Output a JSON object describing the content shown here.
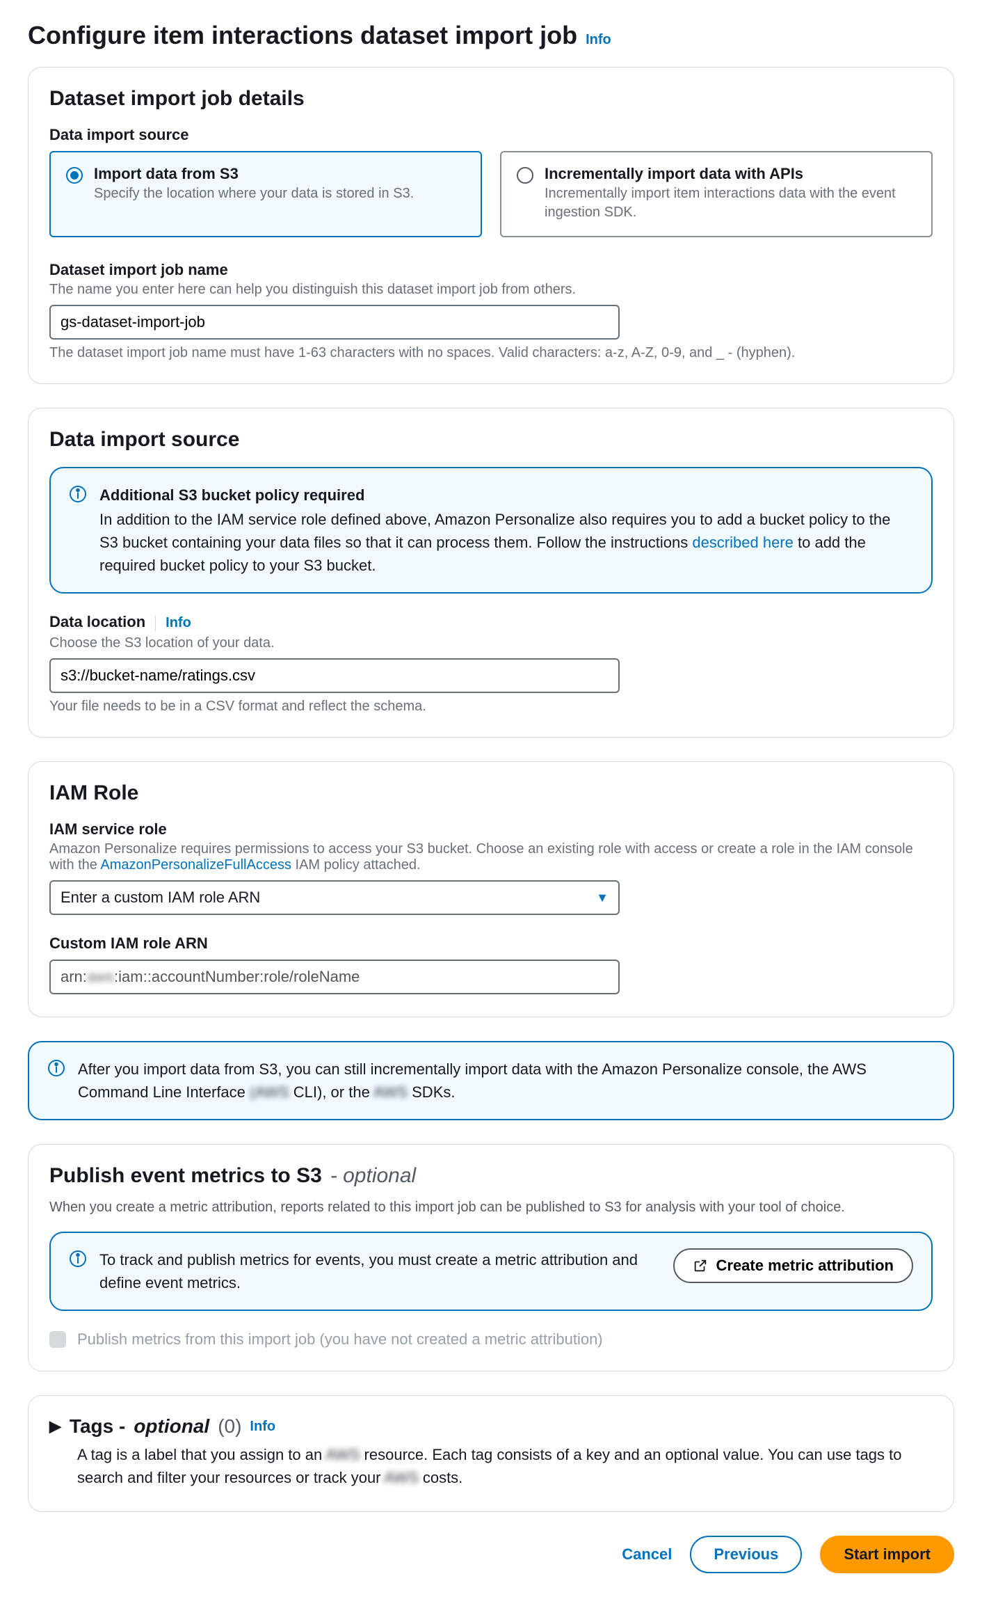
{
  "page": {
    "title": "Configure item interactions dataset import job",
    "title_info": "Info"
  },
  "details": {
    "title": "Dataset import job details",
    "source_label": "Data import source",
    "tiles": [
      {
        "title": "Import data from S3",
        "desc": "Specify the location where your data is stored in S3.",
        "selected": true
      },
      {
        "title": "Incrementally import data with APIs",
        "desc": "Incrementally import item interactions data with the event ingestion SDK.",
        "selected": false
      }
    ],
    "jobname_label": "Dataset import job name",
    "jobname_help": "The name you enter here can help you distinguish this dataset import job from others.",
    "jobname_value": "gs-dataset-import-job",
    "jobname_hint": "The dataset import job name must have 1-63 characters with no spaces. Valid characters: a-z, A-Z, 0-9, and _ - (hyphen)."
  },
  "source": {
    "title": "Data import source",
    "info_title": "Additional S3 bucket policy required",
    "info_body_1": "In addition to the IAM service role defined above, Amazon Personalize also requires you to add a bucket policy to the S3 bucket containing your data files so that it can process them. Follow the instructions ",
    "info_link": "described here",
    "info_body_2": " to add the required bucket policy to your S3 bucket.",
    "loc_label": "Data location",
    "loc_info": "Info",
    "loc_help": "Choose the S3 location of your data.",
    "loc_value": "s3://bucket-name/ratings.csv",
    "loc_hint": "Your file needs to be in a CSV format and reflect the schema."
  },
  "iam": {
    "title": "IAM Role",
    "role_label": "IAM service role",
    "role_help_1": "Amazon Personalize requires permissions to access your S3 bucket. Choose an existing role with access or create a role in the IAM console with the ",
    "role_help_link": "AmazonPersonalizeFullAccess",
    "role_help_2": " IAM policy attached.",
    "select_value": "Enter a custom IAM role ARN",
    "arn_label": "Custom IAM role ARN",
    "arn_prefix": "arn:",
    "arn_redacted": "aws",
    "arn_suffix": ":iam::accountNumber:role/roleName"
  },
  "global_info": {
    "t1": "After you import data from S3, you can still incrementally import data with the Amazon Personalize console, the AWS Command Line Interface ",
    "r1": "(AWS",
    "t2": " CLI), or the ",
    "r2": "AWS",
    "t3": " SDKs."
  },
  "metrics": {
    "title": "Publish event metrics to S3",
    "optional": "- optional",
    "desc": "When you create a metric attribution, reports related to this import job can be published to S3 for analysis with your tool of choice.",
    "info_text": "To track and publish metrics for events, you must create a metric attribution and define event metrics.",
    "button": "Create metric attribution",
    "checkbox": "Publish metrics from this import job (you have not created a metric attribution)"
  },
  "tags": {
    "label": "Tags -",
    "optional": "optional",
    "count": "(0)",
    "info": "Info",
    "body_1": "A tag is a label that you assign to an ",
    "r1": "AWS",
    "body_2": " resource. Each tag consists of a key and an optional value. You can use tags to search and filter your resources or track your ",
    "r2": "AWS",
    "body_3": " costs."
  },
  "footer": {
    "cancel": "Cancel",
    "previous": "Previous",
    "start": "Start import"
  }
}
